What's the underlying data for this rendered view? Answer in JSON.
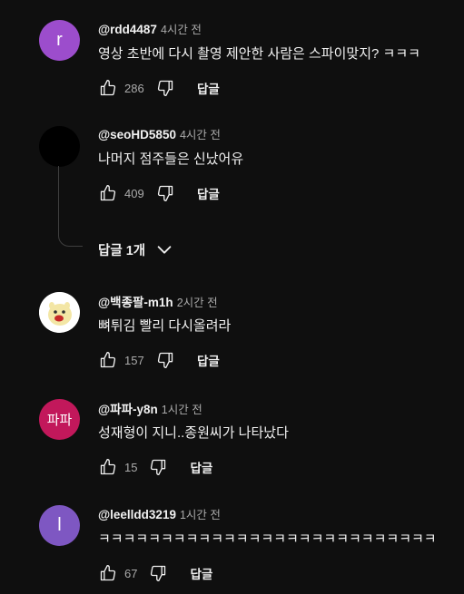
{
  "comments": [
    {
      "avatar_letter": "r",
      "avatar_color": "#9c4dcc",
      "author": "@rdd4487",
      "time": "4시간 전",
      "text": "영상 초반에 다시 촬영 제안한 사람은 스파이맞지? ㅋㅋㅋ",
      "likes": "286",
      "reply_label": "답글"
    },
    {
      "avatar_letter": "",
      "avatar_color": "#000000",
      "author": "@seoHD5850",
      "time": "4시간 전",
      "text": "나머지 점주들은 신났어유",
      "likes": "409",
      "reply_label": "답글",
      "replies_label": "답글 1개"
    },
    {
      "avatar_letter": "",
      "avatar_color": "#ffffff",
      "author": "@백종팔-m1h",
      "time": "2시간 전",
      "text": "뼈튀김 빨리 다시올려라",
      "likes": "157",
      "reply_label": "답글"
    },
    {
      "avatar_letter": "파파",
      "avatar_color": "#c2185b",
      "author": "@파파-y8n",
      "time": "1시간 전",
      "text": "성재형이 지니..종원씨가 나타났다",
      "likes": "15",
      "reply_label": "답글"
    },
    {
      "avatar_letter": "l",
      "avatar_color": "#7e57c2",
      "author": "@leelldd3219",
      "time": "1시간 전",
      "text": "ㅋㅋㅋㅋㅋㅋㅋㅋㅋㅋㅋㅋㅋㅋㅋㅋㅋㅋㅋㅋㅋㅋㅋㅋㅋㅋㅋ",
      "likes": "67",
      "reply_label": "답글"
    }
  ],
  "icons": {
    "like": "thumbs-up-icon",
    "dislike": "thumbs-down-icon",
    "expand": "chevron-down-icon"
  }
}
